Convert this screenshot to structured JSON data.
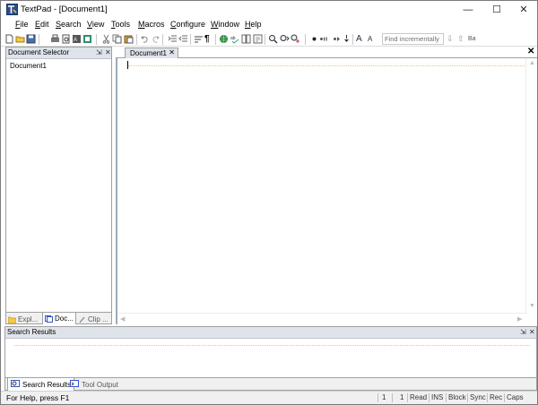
{
  "window": {
    "title": "TextPad - [Document1]",
    "minimize_glyph": "—",
    "maximize_glyph": "☐",
    "close_glyph": "✕"
  },
  "menu": [
    {
      "label": "File",
      "accel": "F"
    },
    {
      "label": "Edit",
      "accel": "E"
    },
    {
      "label": "Search",
      "accel": "S"
    },
    {
      "label": "View",
      "accel": "V"
    },
    {
      "label": "Tools",
      "accel": "T"
    },
    {
      "label": "Macros",
      "accel": "M"
    },
    {
      "label": "Configure",
      "accel": "C"
    },
    {
      "label": "Window",
      "accel": "W"
    },
    {
      "label": "Help",
      "accel": "H"
    }
  ],
  "toolbar": {
    "icons": [
      "new-document-icon",
      "open-folder-icon",
      "save-icon",
      "print-icon",
      "print-preview-icon",
      "spell-icon",
      "properties-icon",
      "cut-icon",
      "copy-icon",
      "paste-icon",
      "undo-icon",
      "redo-icon",
      "indent-icon",
      "outdent-icon",
      "word-wrap-icon",
      "pilcrow-icon",
      "web-browser-icon",
      "check-spelling-icon",
      "compare-icon",
      "file-properties-icon",
      "find-icon",
      "find-next-icon",
      "replace-icon",
      "record-macro-icon",
      "play-macro-icon",
      "run-macro-icon",
      "increase-font-icon",
      "decrease-font-icon"
    ],
    "pilcrow": "¶",
    "font_larger": "A",
    "font_smaller": "A",
    "find_placeholder": "Find incrementally",
    "find_down": "⇩",
    "find_up": "⇧",
    "match_case": "Ba"
  },
  "document_selector": {
    "title": "Document Selector",
    "pin": "⇲",
    "close": "✕",
    "items": [
      "Document1"
    ],
    "tabs": [
      {
        "label": "Expl...",
        "icon": "explorer-icon"
      },
      {
        "label": "Doc...",
        "icon": "documents-icon"
      },
      {
        "label": "Clip ...",
        "icon": "clip-library-icon"
      }
    ]
  },
  "editor": {
    "tab_label": "Document1",
    "tab_close": "✕",
    "close_all": "✕"
  },
  "search_results": {
    "title": "Search Results",
    "pin": "⇲",
    "close": "✕",
    "tabs": [
      {
        "label": "Search Results",
        "icon": "search-results-icon"
      },
      {
        "label": "Tool Output",
        "icon": "tool-output-icon"
      }
    ]
  },
  "status": {
    "help": "For Help, press F1",
    "line": "1",
    "col": "1",
    "read": "Read",
    "ins": "INS",
    "block": "Block",
    "sync": "Sync",
    "rec": "Rec",
    "caps": "Caps"
  },
  "colors": {
    "panel_header": "#dfe3ea",
    "guide_line": "#e6c96a",
    "border": "#a0a0a0"
  }
}
